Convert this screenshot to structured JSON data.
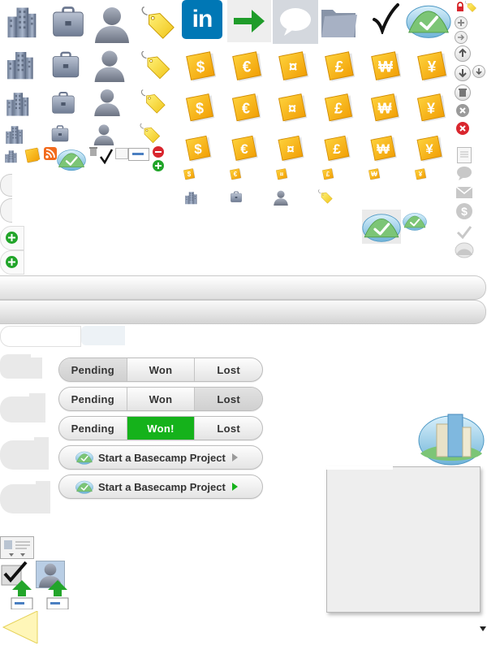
{
  "segmented_controls": [
    {
      "options": [
        "Pending",
        "Won",
        "Lost"
      ],
      "state": "default"
    },
    {
      "options": [
        "Pending",
        "Won",
        "Lost"
      ],
      "state": "lost-pressed"
    },
    {
      "options": [
        "Pending",
        "Won!",
        "Lost"
      ],
      "state": "won-active"
    }
  ],
  "basecamp_buttons": [
    {
      "label": "Start a Basecamp Project",
      "arrow": "gray"
    },
    {
      "label": "Start a Basecamp Project",
      "arrow": "green"
    }
  ],
  "linkedin_badge": "in",
  "currency_symbols": [
    "$",
    "€",
    "¤",
    "£",
    "₩",
    "¥"
  ],
  "icons": {
    "row_sizes": [
      48,
      40,
      32,
      24
    ],
    "kinds": [
      "company-building",
      "briefcase",
      "person",
      "price-tag"
    ]
  },
  "colors": {
    "accent_green": "#15b21b",
    "currency_yellow": "#f4b800",
    "linkedin_blue": "#0077b5",
    "delete_red": "#d9262e",
    "basecamp_green": "#7cc576"
  }
}
